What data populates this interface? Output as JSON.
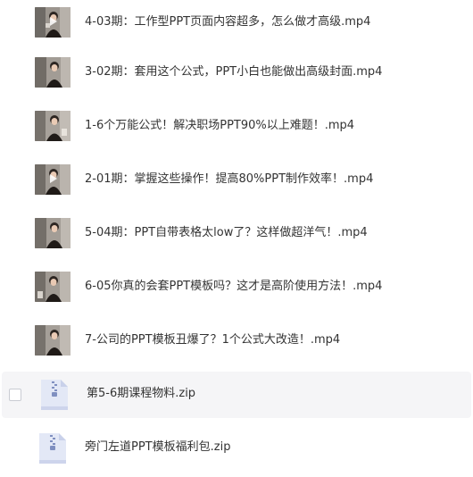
{
  "files": [
    {
      "name": "4-03期：工作型PPT页面内容超多，怎么做才高级.mp4",
      "type": "video",
      "icon": "video-thumbnail-icon"
    },
    {
      "name": "3-02期：套用这个公式，PPT小白也能做出高级封面.mp4",
      "type": "video",
      "icon": "video-thumbnail-icon"
    },
    {
      "name": "1-6个万能公式！解决职场PPT90%以上难题！.mp4",
      "type": "video",
      "icon": "video-thumbnail-icon"
    },
    {
      "name": "2-01期：掌握这些操作！提高80%PPT制作效率！.mp4",
      "type": "video",
      "icon": "video-thumbnail-icon"
    },
    {
      "name": "5-04期：PPT自带表格太low了？这样做超洋气！.mp4",
      "type": "video",
      "icon": "video-thumbnail-icon"
    },
    {
      "name": "6-05你真的会套PPT模板吗？这才是高阶使用方法！.mp4",
      "type": "video",
      "icon": "video-thumbnail-icon"
    },
    {
      "name": "7-公司的PPT模板丑爆了？1个公式大改造！.mp4",
      "type": "video",
      "icon": "video-thumbnail-icon"
    },
    {
      "name": "第5-6期课程物料.zip",
      "type": "zip",
      "icon": "zip-file-icon",
      "hovered": true
    },
    {
      "name": "旁门左道PPT模板福利包.zip",
      "type": "zip",
      "icon": "zip-file-icon"
    }
  ],
  "colors": {
    "text": "#333333",
    "hover_row": "#f5f5f7",
    "checkbox_border": "#c9ccd3",
    "zip_icon": "#e3e8f6"
  }
}
